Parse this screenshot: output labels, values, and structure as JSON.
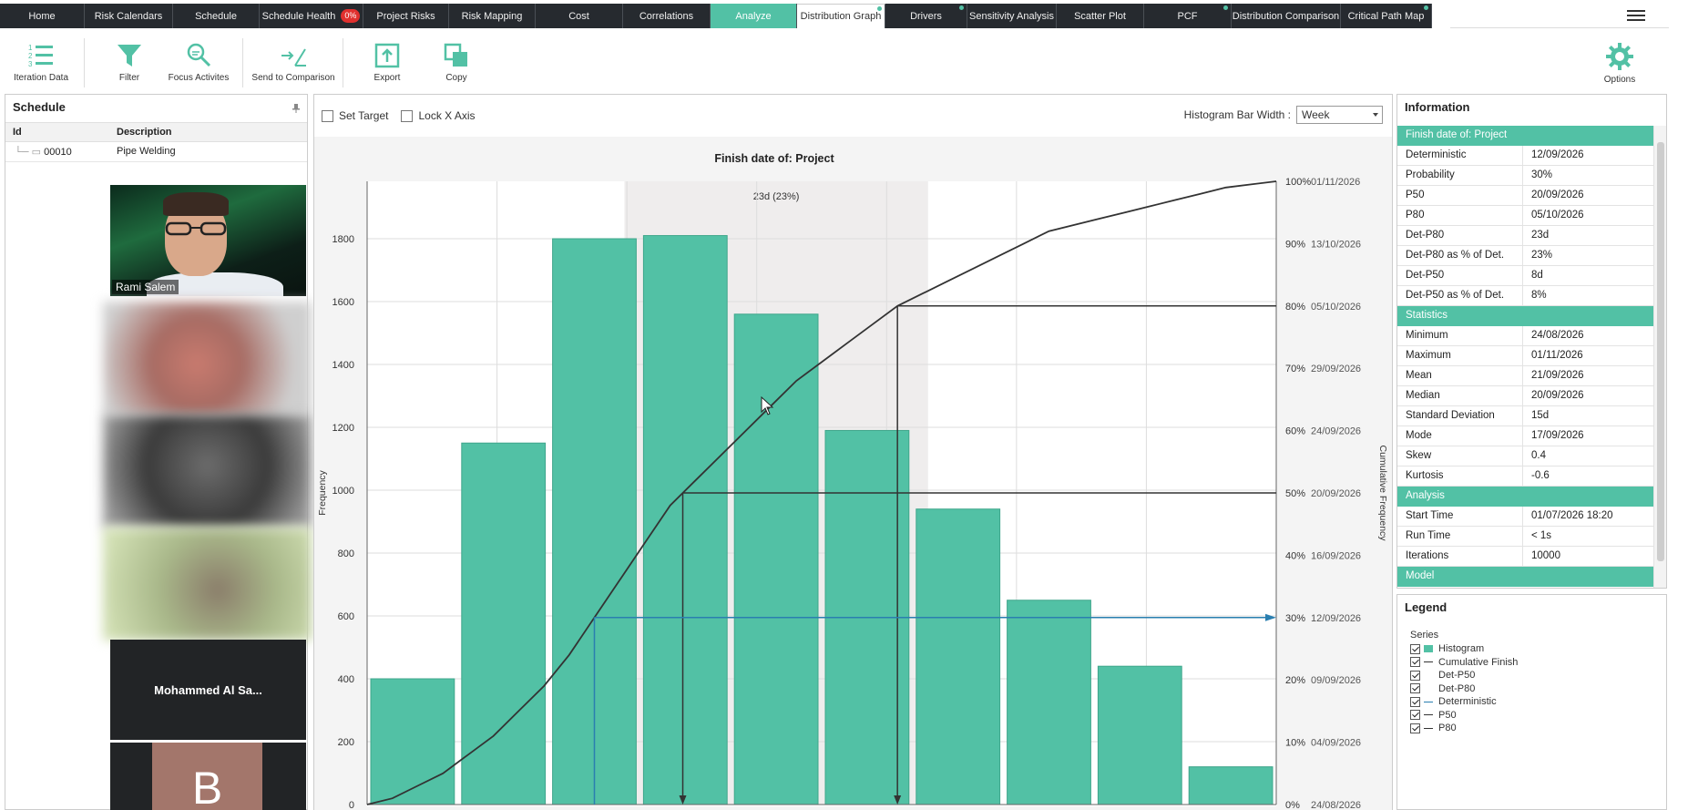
{
  "tabs": [
    {
      "label": "Home",
      "w": 93,
      "state": "normal",
      "dot": false
    },
    {
      "label": "Risk Calendars",
      "w": 97,
      "state": "normal",
      "dot": false
    },
    {
      "label": "Schedule",
      "w": 95,
      "state": "normal",
      "dot": false
    },
    {
      "label": "Schedule Health",
      "w": 114,
      "state": "normal",
      "dot": false,
      "badge": "0%"
    },
    {
      "label": "Project Risks",
      "w": 94,
      "state": "normal",
      "dot": false
    },
    {
      "label": "Risk Mapping",
      "w": 95,
      "state": "normal",
      "dot": false
    },
    {
      "label": "Cost",
      "w": 96,
      "state": "normal",
      "dot": false
    },
    {
      "label": "Correlations",
      "w": 96,
      "state": "normal",
      "dot": false
    },
    {
      "label": "Analyze",
      "w": 95,
      "state": "active",
      "dot": false
    },
    {
      "label": "Distribution Graph",
      "w": 97,
      "state": "selected",
      "dot": true
    },
    {
      "label": "Drivers",
      "w": 90,
      "state": "normal",
      "dot": true
    },
    {
      "label": "Sensitivity Analysis",
      "w": 98,
      "state": "normal",
      "dot": false
    },
    {
      "label": "Scatter Plot",
      "w": 96,
      "state": "normal",
      "dot": false
    },
    {
      "label": "PCF",
      "w": 96,
      "state": "normal",
      "dot": true
    },
    {
      "label": "Distribution Comparison",
      "w": 120,
      "state": "normal",
      "dot": false
    },
    {
      "label": "Critical Path Map",
      "w": 100,
      "state": "normal",
      "dot": true
    }
  ],
  "toolbar": {
    "iteration_data": "Iteration Data",
    "filter": "Filter",
    "focus_activities": "Focus Activites",
    "send_to_comparison": "Send to Comparison",
    "export": "Export",
    "copy": "Copy",
    "options": "Options"
  },
  "schedule": {
    "title": "Schedule",
    "col_id": "Id",
    "col_desc": "Description",
    "rows": [
      {
        "id": "00010",
        "desc": "Pipe Welding"
      }
    ]
  },
  "participants": {
    "person_name": "Rami Salem",
    "tile_name": "Mohammed Al Sa...",
    "avatar_letter": "B"
  },
  "chart_controls": {
    "set_target": "Set Target",
    "lock_x_axis": "Lock X Axis",
    "bar_width_label": "Histogram Bar Width :",
    "bar_width_value": "Week"
  },
  "info": {
    "title": "Information",
    "sections": [
      {
        "title": "Finish date of: Project",
        "rows": [
          [
            "Deterministic",
            "12/09/2026"
          ],
          [
            "Probability",
            "30%"
          ],
          [
            "P50",
            "20/09/2026"
          ],
          [
            "P80",
            "05/10/2026"
          ],
          [
            "Det-P80",
            "23d"
          ],
          [
            "Det-P80 as % of Det.",
            "23%"
          ],
          [
            "Det-P50",
            "8d"
          ],
          [
            "Det-P50 as % of Det.",
            "8%"
          ]
        ]
      },
      {
        "title": "Statistics",
        "rows": [
          [
            "Minimum",
            "24/08/2026"
          ],
          [
            "Maximum",
            "01/11/2026"
          ],
          [
            "Mean",
            "21/09/2026"
          ],
          [
            "Median",
            "20/09/2026"
          ],
          [
            "Standard Deviation",
            "15d"
          ],
          [
            "Mode",
            "17/09/2026"
          ],
          [
            "Skew",
            "0.4"
          ],
          [
            "Kurtosis",
            "-0.6"
          ]
        ]
      },
      {
        "title": "Analysis",
        "rows": [
          [
            "Start Time",
            "01/07/2026 18:20"
          ],
          [
            "Run Time",
            "< 1s"
          ],
          [
            "Iterations",
            "10000"
          ]
        ]
      },
      {
        "title": "Model",
        "rows": []
      }
    ]
  },
  "legend": {
    "title": "Legend",
    "group": "Series",
    "items": [
      {
        "label": "Histogram",
        "kind": "swatch",
        "color": "#52c1a5"
      },
      {
        "label": "Cumulative Finish",
        "kind": "line",
        "color": "#333333"
      },
      {
        "label": "Det-P50",
        "kind": "none",
        "color": "#333333"
      },
      {
        "label": "Det-P80",
        "kind": "none",
        "color": "#333333"
      },
      {
        "label": "Deterministic",
        "kind": "line",
        "color": "#2a7fb0"
      },
      {
        "label": "P50",
        "kind": "line",
        "color": "#333333"
      },
      {
        "label": "P80",
        "kind": "line",
        "color": "#333333"
      }
    ]
  },
  "chart_data": {
    "type": "bar",
    "title": "Finish date of: Project",
    "ylabel": "Frequency",
    "y2label": "Cumulative Frequency",
    "ylim": [
      0,
      2000
    ],
    "yticks": [
      0,
      200,
      400,
      600,
      800,
      1000,
      1200,
      1400,
      1600,
      1800
    ],
    "series": [
      {
        "name": "Histogram",
        "values": [
          400,
          1150,
          1800,
          1810,
          1560,
          1190,
          940,
          650,
          440,
          120
        ]
      }
    ],
    "cumulative": {
      "name": "Cumulative Finish",
      "y": [
        0,
        1,
        3,
        5,
        8,
        11,
        15,
        19,
        24,
        30,
        36,
        42,
        48,
        52,
        56,
        60,
        64,
        68,
        71,
        74,
        77,
        80,
        82,
        84,
        86,
        88,
        90,
        92,
        93,
        94,
        95,
        96,
        97,
        98,
        99,
        99.5,
        100
      ]
    },
    "y2_ticks": [
      {
        "pct": "0%",
        "date": "24/08/2026"
      },
      {
        "pct": "10%",
        "date": "04/09/2026"
      },
      {
        "pct": "20%",
        "date": "09/09/2026"
      },
      {
        "pct": "30%",
        "date": "12/09/2026"
      },
      {
        "pct": "40%",
        "date": "16/09/2026"
      },
      {
        "pct": "50%",
        "date": "20/09/2026"
      },
      {
        "pct": "60%",
        "date": "24/09/2026"
      },
      {
        "pct": "70%",
        "date": "29/09/2026"
      },
      {
        "pct": "80%",
        "date": "05/10/2026"
      },
      {
        "pct": "90%",
        "date": "13/10/2026"
      },
      {
        "pct": "100%",
        "date": "01/11/2026"
      }
    ],
    "deterministic_pct": 30,
    "p50_pct": 50,
    "p80_pct": 80,
    "det_p80_annotation": "23d (23%)",
    "accent_color": "#52c1a5"
  }
}
